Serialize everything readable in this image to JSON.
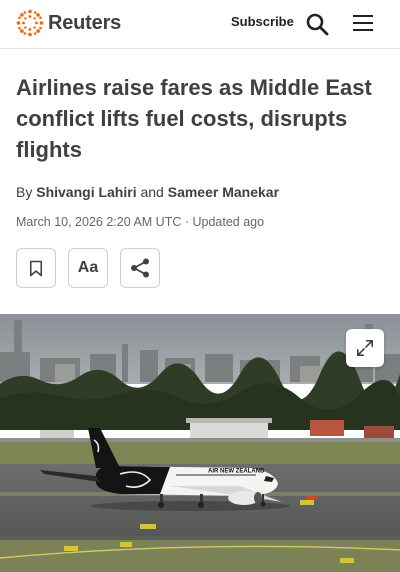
{
  "header": {
    "brand": "Reuters",
    "subscribe_label": "Subscribe",
    "search_icon": "search-icon",
    "menu_icon": "hamburger-menu-icon"
  },
  "article": {
    "headline": "Airlines raise fares as Middle East conflict lifts fuel costs, disrupts flights",
    "byline_prefix": "By",
    "author_1": "Shivangi Lahiri",
    "byline_joiner": "and",
    "author_2": "Sameer Manekar",
    "date": "March 10, 2026 2:20 AM UTC",
    "updated": "· Updated ago"
  },
  "actions": {
    "bookmark_icon": "bookmark-icon",
    "text_size_label": "Aa",
    "share_icon": "share-icon"
  },
  "image": {
    "expand_icon": "expand-icon",
    "aircraft_livery": "AIR NEW ZEALAND"
  },
  "colors": {
    "brand_orange": "#fa6400",
    "text": "#404040",
    "muted": "#666666"
  }
}
